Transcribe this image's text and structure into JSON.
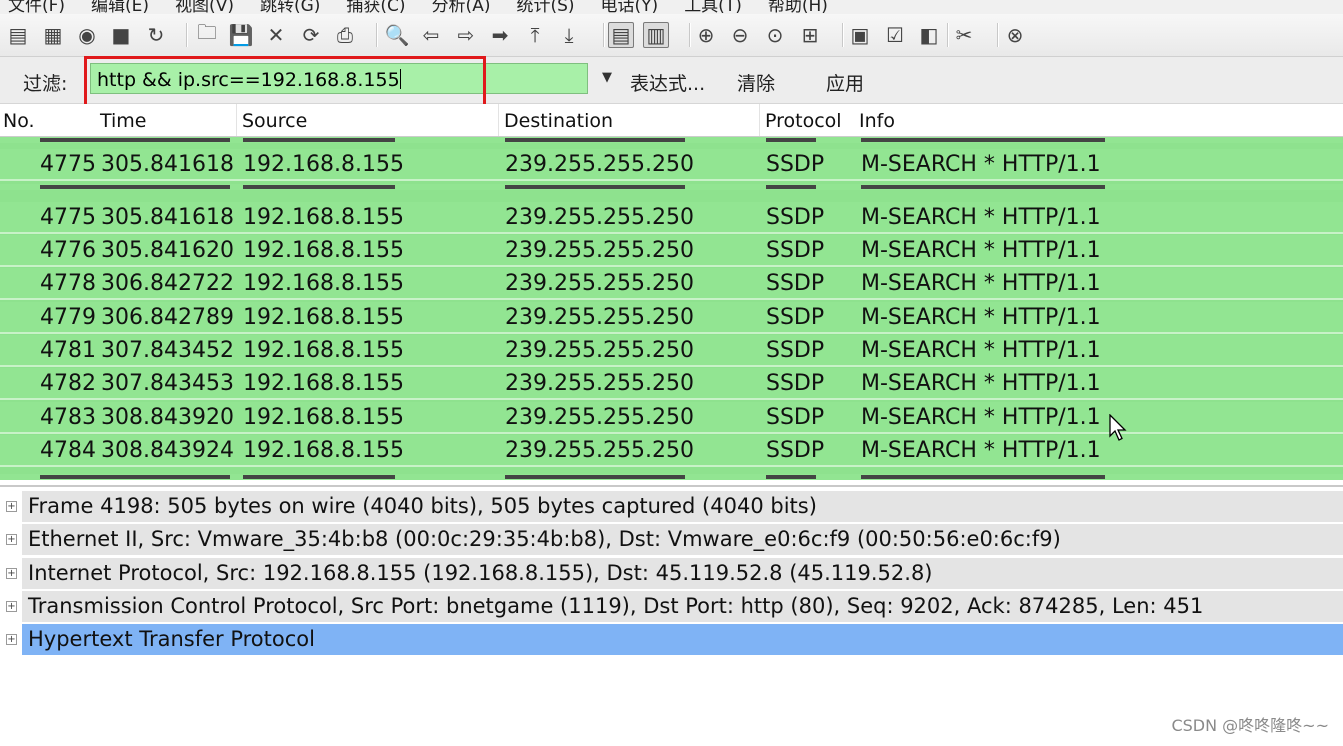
{
  "menubar": {
    "items": [
      "文件(F)",
      "编辑(E)",
      "视图(V)",
      "跳转(G)",
      "捕获(C)",
      "分析(A)",
      "统计(S)",
      "电话(Y)",
      "工具(T)",
      "帮助(H)"
    ]
  },
  "toolbar": {
    "icons": [
      "interface-list-icon",
      "capture-options-icon",
      "start-capture-icon",
      "stop-capture-icon",
      "restart-capture-icon",
      "open-file-icon",
      "save-file-icon",
      "close-file-icon",
      "reload-icon",
      "print-icon",
      "find-packet-icon",
      "go-back-icon",
      "go-forward-icon",
      "go-to-packet-icon",
      "go-first-icon",
      "go-last-icon",
      "colorize-icon",
      "autoscroll-icon",
      "zoom-in-icon",
      "zoom-out-icon",
      "zoom-normal-icon",
      "resize-columns-icon",
      "capture-filters-icon",
      "display-filters-icon",
      "coloring-rules-icon",
      "preferences-icon",
      "help-icon"
    ]
  },
  "filter": {
    "label": "过滤:",
    "value": "http && ip.src==192.168.8.155",
    "expression_label": "表达式...",
    "clear_label": "清除",
    "apply_label": "应用"
  },
  "columns": {
    "no": "No.",
    "time": "Time",
    "source": "Source",
    "destination": "Destination",
    "protocol": "Protocol",
    "info": "Info"
  },
  "packets": [
    {
      "no": "4775",
      "time": "305.841618",
      "source": "192.168.8.155",
      "destination": "239.255.255.250",
      "protocol": "SSDP",
      "info": "M-SEARCH * HTTP/1.1"
    },
    {
      "no": "4775",
      "time": "305.841618",
      "source": "192.168.8.155",
      "destination": "239.255.255.250",
      "protocol": "SSDP",
      "info": "M-SEARCH * HTTP/1.1"
    },
    {
      "no": "4776",
      "time": "305.841620",
      "source": "192.168.8.155",
      "destination": "239.255.255.250",
      "protocol": "SSDP",
      "info": "M-SEARCH * HTTP/1.1"
    },
    {
      "no": "4778",
      "time": "306.842722",
      "source": "192.168.8.155",
      "destination": "239.255.255.250",
      "protocol": "SSDP",
      "info": "M-SEARCH * HTTP/1.1"
    },
    {
      "no": "4779",
      "time": "306.842789",
      "source": "192.168.8.155",
      "destination": "239.255.255.250",
      "protocol": "SSDP",
      "info": "M-SEARCH * HTTP/1.1"
    },
    {
      "no": "4781",
      "time": "307.843452",
      "source": "192.168.8.155",
      "destination": "239.255.255.250",
      "protocol": "SSDP",
      "info": "M-SEARCH * HTTP/1.1"
    },
    {
      "no": "4782",
      "time": "307.843453",
      "source": "192.168.8.155",
      "destination": "239.255.255.250",
      "protocol": "SSDP",
      "info": "M-SEARCH * HTTP/1.1"
    },
    {
      "no": "4783",
      "time": "308.843920",
      "source": "192.168.8.155",
      "destination": "239.255.255.250",
      "protocol": "SSDP",
      "info": "M-SEARCH * HTTP/1.1"
    },
    {
      "no": "4784",
      "time": "308.843924",
      "source": "192.168.8.155",
      "destination": "239.255.255.250",
      "protocol": "SSDP",
      "info": "M-SEARCH * HTTP/1.1"
    }
  ],
  "details": [
    {
      "text": "Frame 4198: 505 bytes on wire (4040 bits), 505 bytes captured (4040 bits)",
      "selected": false
    },
    {
      "text": "Ethernet II, Src: Vmware_35:4b:b8 (00:0c:29:35:4b:b8), Dst: Vmware_e0:6c:f9 (00:50:56:e0:6c:f9)",
      "selected": false
    },
    {
      "text": "Internet Protocol, Src: 192.168.8.155 (192.168.8.155), Dst: 45.119.52.8 (45.119.52.8)",
      "selected": false
    },
    {
      "text": "Transmission Control Protocol, Src Port: bnetgame (1119), Dst Port: http (80), Seq: 9202, Ack: 874285, Len: 451",
      "selected": false
    },
    {
      "text": "Hypertext Transfer Protocol",
      "selected": true
    }
  ],
  "colors": {
    "filter_valid": "#a8f0a8",
    "packet_row": "#92e592",
    "selected_detail": "#7fb3f5",
    "highlight_box": "#e0191b"
  },
  "watermark": "CSDN @咚咚隆咚~~"
}
